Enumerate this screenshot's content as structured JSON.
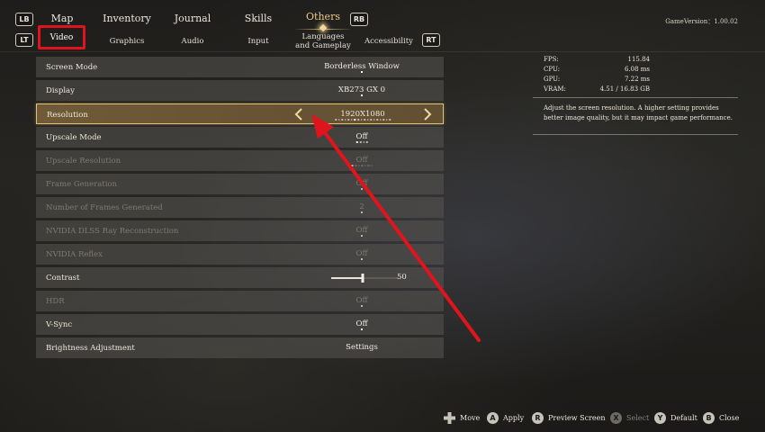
{
  "header": {
    "lb": "LB",
    "rb": "RB",
    "lt": "LT",
    "rt": "RT",
    "main_tabs": [
      "Map",
      "Inventory",
      "Journal",
      "Skills",
      "Others"
    ],
    "sub_tabs": [
      "Video",
      "Graphics",
      "Audio",
      "Input",
      "Languages and Gameplay",
      "Accessibility"
    ],
    "version": "GameVersion：1.00.02"
  },
  "settings": [
    {
      "label": "Screen Mode",
      "value": "Borderless Window",
      "enabled": true
    },
    {
      "label": "Display",
      "value": "XB273 GX 0",
      "enabled": true
    },
    {
      "label": "Resolution",
      "value": "1920X1080",
      "enabled": true,
      "selected": true
    },
    {
      "label": "Upscale Mode",
      "value": "Off",
      "enabled": true
    },
    {
      "label": "Upscale Resolution",
      "value": "Off",
      "enabled": false
    },
    {
      "label": "Frame Generation",
      "value": "Off",
      "enabled": false
    },
    {
      "label": "Number of Frames Generated",
      "value": "2",
      "enabled": false
    },
    {
      "label": "NVIDIA DLSS Ray Reconstruction",
      "value": "Off",
      "enabled": false
    },
    {
      "label": "NVIDIA Reflex",
      "value": "Off",
      "enabled": false
    },
    {
      "label": "Contrast",
      "value": "50",
      "enabled": true,
      "slider": 0.47
    },
    {
      "label": "HDR",
      "value": "Off",
      "enabled": false
    },
    {
      "label": "V-Sync",
      "value": "Off",
      "enabled": true
    },
    {
      "label": "Brightness Adjustment",
      "value": "Settings",
      "enabled": true
    }
  ],
  "stats": {
    "fps_label": "FPS:",
    "fps": "115.84",
    "cpu_label": "CPU:",
    "cpu": "6.08  ms",
    "gpu_label": "GPU:",
    "gpu": "7.22  ms",
    "vram_label": "VRAM:",
    "vram": "4.51  /  16.83  GB"
  },
  "description": "Adjust the screen resolution. A higher setting provides better image quality, but it may impact game performance.",
  "hints": {
    "move": "Move",
    "apply": "Apply",
    "preview": "Preview Screen",
    "select": "Select",
    "default": "Default",
    "close": "Close",
    "a": "A",
    "r": "R",
    "x": "X",
    "y": "Y",
    "b": "B"
  },
  "colors": {
    "highlight_border": "#e2c276",
    "annotation_red": "#e0141c",
    "active_tab": "#e9c98a"
  }
}
